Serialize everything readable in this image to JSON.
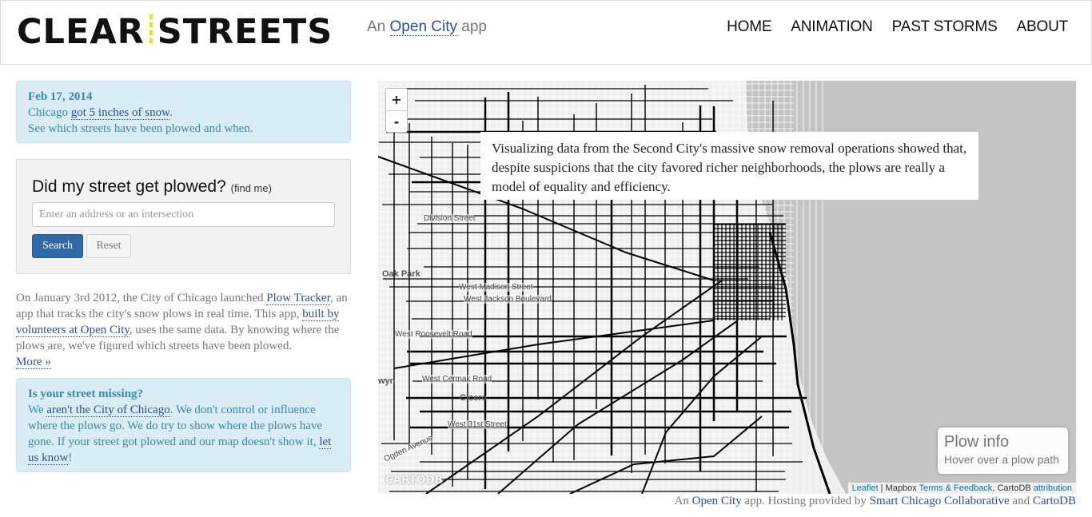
{
  "header": {
    "logo_left": "CLEAR",
    "logo_right": "STREETS",
    "tagline_prefix": "An",
    "tagline_link": "Open City",
    "tagline_suffix": "app",
    "nav": [
      "HOME",
      "ANIMATION",
      "PAST STORMS",
      "ABOUT"
    ]
  },
  "storm_alert": {
    "date": "Feb 17, 2014",
    "line1_prefix": "Chicago",
    "line1_link": "got 5 inches of snow",
    "line1_suffix": ".",
    "line2": "See which streets have been plowed and when."
  },
  "search": {
    "title": "Did my street get plowed?",
    "find_me": "find me",
    "placeholder": "Enter an address or an intersection",
    "search_label": "Search",
    "reset_label": "Reset"
  },
  "about": {
    "text1": "On January 3rd 2012, the City of Chicago launched",
    "link1": "Plow Tracker",
    "text2": ", an app that tracks the city's snow plows in real time. This app,",
    "link2": "built by volunteers at Open City",
    "text3": ", uses the same data. By knowing where the plows are, we've figured which streets have been plowed.",
    "more": "More »"
  },
  "missing": {
    "title": "Is your street missing?",
    "text1": "We",
    "link1": "aren't the City of Chicago",
    "text2": ". We don't control or influence where the plows go. We do try to show where the plows have gone. If your street got plowed and our map doesn't show it,",
    "link2": "let us know",
    "text3": "!"
  },
  "map": {
    "zoom_in": "+",
    "zoom_out": "-",
    "overlay_text": "Visualizing data from the Second City's massive snow removal operations showed that, despite suspicions that the city favored richer neighborhoods, the plows are really a model of equality and efficiency.",
    "plow_info_title": "Plow info",
    "plow_info_sub": "Hover over a plow path",
    "cartodb_logo": "CARTODB",
    "labels": {
      "division": "Division Street",
      "oak_park": "Oak Park",
      "madison": "West Madison Street",
      "jackson": "West Jackson Boulevard",
      "roosevelt": "West Roosevelt Road",
      "cermak": "West Cermak Road",
      "cicero": "Cicero",
      "w31st": "West 31st Street",
      "ogden": "Ogden Avenue",
      "berwyn": "wyn"
    },
    "attribution": {
      "leaflet": "Leaflet",
      "mapbox": "Mapbox",
      "terms": "Terms & Feedback",
      "cartodb": "CartoDB",
      "attr": "attribution"
    }
  },
  "footer": {
    "prefix": "An",
    "link1": "Open City",
    "mid": "app. Hosting provided by",
    "link2": "Smart Chicago Collaborative",
    "and": "and",
    "link3": "CartoDB"
  }
}
